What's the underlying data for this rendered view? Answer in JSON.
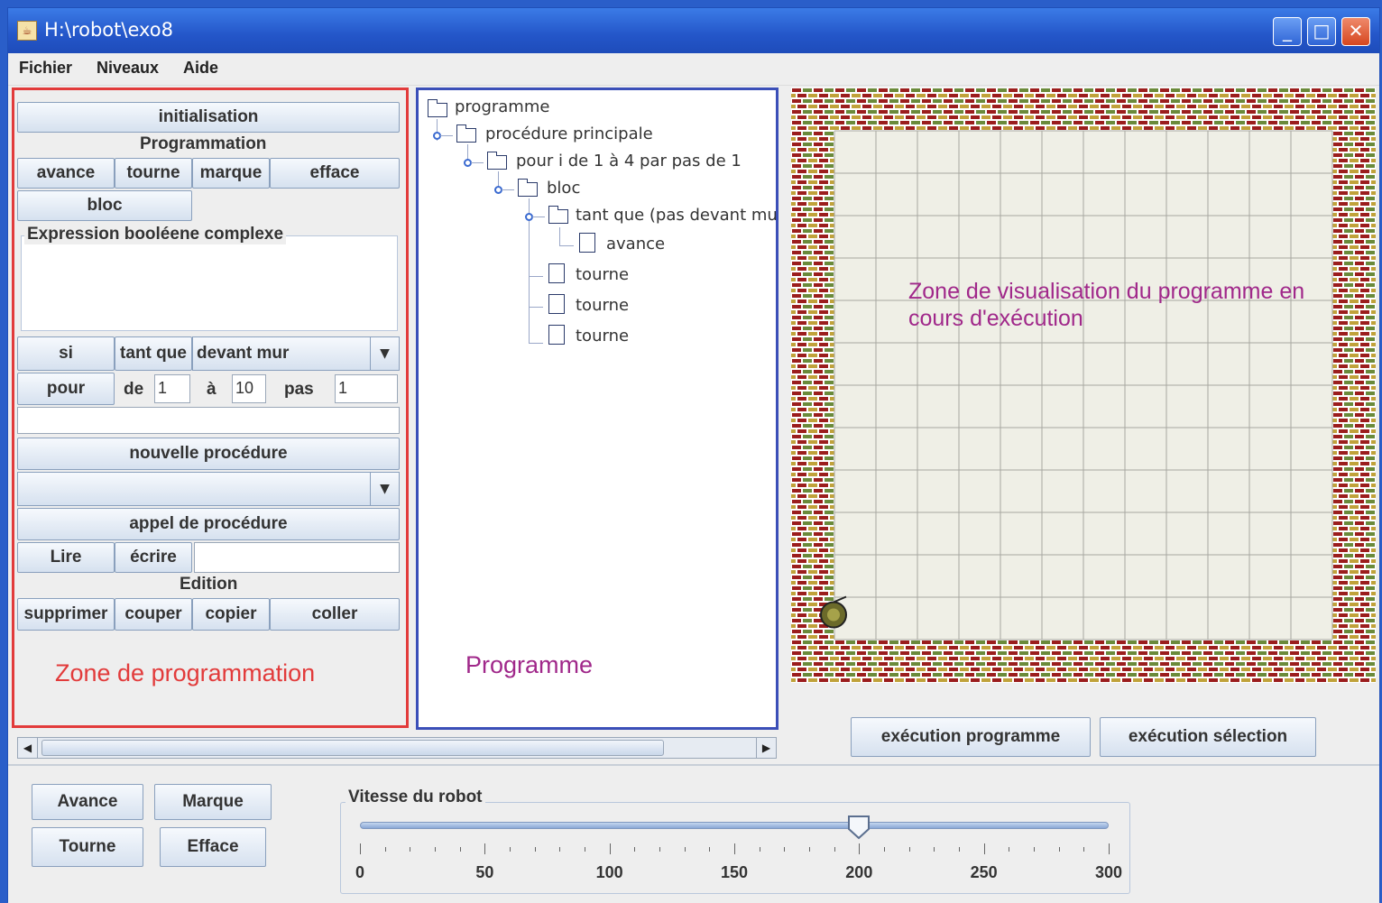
{
  "window": {
    "title": "H:\\robot\\exo8"
  },
  "menu": [
    "Fichier",
    "Niveaux",
    "Aide"
  ],
  "prog_zone": {
    "init_label": "initialisation",
    "programmation_label": "Programmation",
    "avance": "avance",
    "tourne": "tourne",
    "marque": "marque",
    "efface": "efface",
    "bloc": "bloc",
    "expr_title": "Expression booléene complexe",
    "si": "si",
    "tant_que": "tant que",
    "condition_value": "devant mur",
    "pour": "pour",
    "de": "de",
    "de_value": "1",
    "a": "à",
    "a_value": "10",
    "pas": "pas",
    "pas_value": "1",
    "nouvelle_procedure": "nouvelle procédure",
    "appel_procedure": "appel de procédure",
    "lire": "Lire",
    "ecrire": "écrire",
    "edition_label": "Edition",
    "supprimer": "supprimer",
    "couper": "couper",
    "copier": "copier",
    "coller": "coller",
    "annotation": "Zone de programmation"
  },
  "program_tree": {
    "root": "programme",
    "main": "procédure principale",
    "loop": "pour i de 1 à 4 par pas de 1",
    "bloc": "bloc",
    "while": "tant que (pas devant mur)",
    "avance": "avance",
    "tourne1": "tourne",
    "tourne2": "tourne",
    "tourne3": "tourne",
    "annotation": "Programme"
  },
  "viz": {
    "annotation": "Zone de visualisation du programme en cours d'exécution",
    "exec_program": "exécution programme",
    "exec_selection": "exécution sélection",
    "grid_cols": 12,
    "grid_rows": 12,
    "wall_color": "#9b1d1d",
    "robot_col": 0,
    "robot_row": 11
  },
  "bottom": {
    "avance": "Avance",
    "marque": "Marque",
    "tourne": "Tourne",
    "efface": "Efface",
    "speed_title": "Vitesse du robot",
    "speed_value": 200,
    "speed_min": 0,
    "speed_max": 300,
    "ticks": [
      "0",
      "50",
      "100",
      "150",
      "200",
      "250",
      "300"
    ]
  }
}
